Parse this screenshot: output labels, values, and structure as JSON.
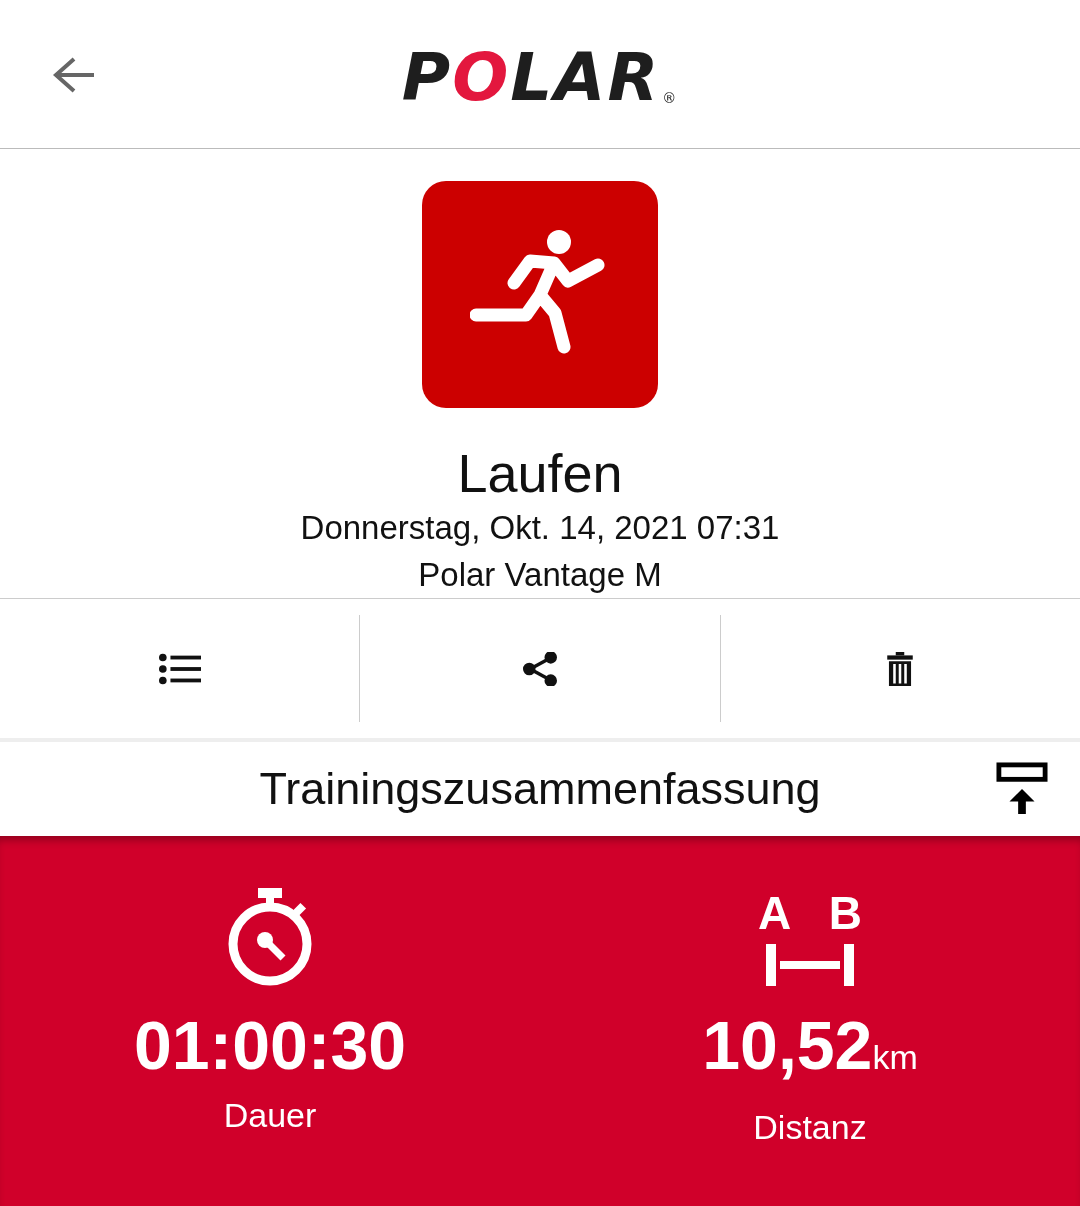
{
  "header": {
    "logo": "POLAR",
    "registered": "®"
  },
  "activity": {
    "title": "Laufen",
    "date": "Donnerstag, Okt. 14, 2021 07:31",
    "device": "Polar Vantage M"
  },
  "actions": [
    {
      "kind": "list"
    },
    {
      "kind": "share"
    },
    {
      "kind": "delete"
    }
  ],
  "summary": {
    "title": "Trainingszusammenfassung",
    "stats": [
      {
        "kind": "duration",
        "value": "01:00:30",
        "label": "Dauer"
      },
      {
        "kind": "distance",
        "value": "10,52",
        "unit": "km",
        "label": "Distanz",
        "start": "A",
        "end": "B"
      }
    ]
  }
}
